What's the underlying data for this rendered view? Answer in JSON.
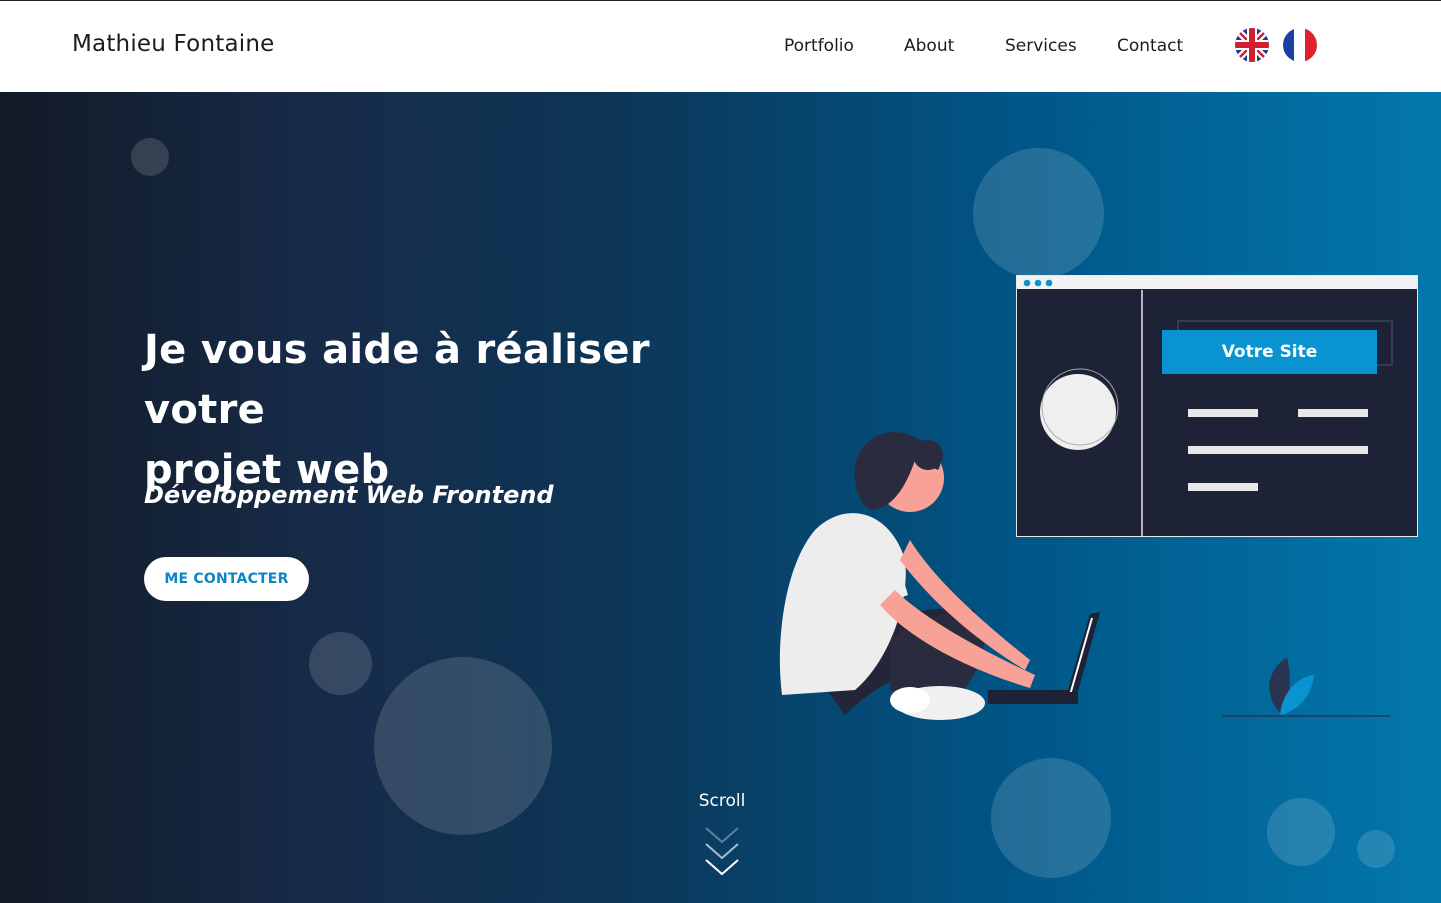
{
  "header": {
    "brand": "Mathieu Fontaine",
    "nav": [
      "Portfolio",
      "About",
      "Services",
      "Contact"
    ],
    "languages": [
      {
        "icon": "uk-flag-icon"
      },
      {
        "icon": "fr-flag-icon"
      }
    ]
  },
  "hero": {
    "headline_line1": "Je vous aide à réaliser votre",
    "headline_line2": "projet web",
    "subtitle": "Développement Web Frontend",
    "cta_label": "ME CONTACTER",
    "scroll_label": "Scroll",
    "illustration_button_label": "Votre Site"
  },
  "colors": {
    "accent": "#0a93d1",
    "cta_text": "#0b86c4",
    "hero_gradient_start": "#121a26",
    "hero_gradient_end": "#0378ac"
  }
}
